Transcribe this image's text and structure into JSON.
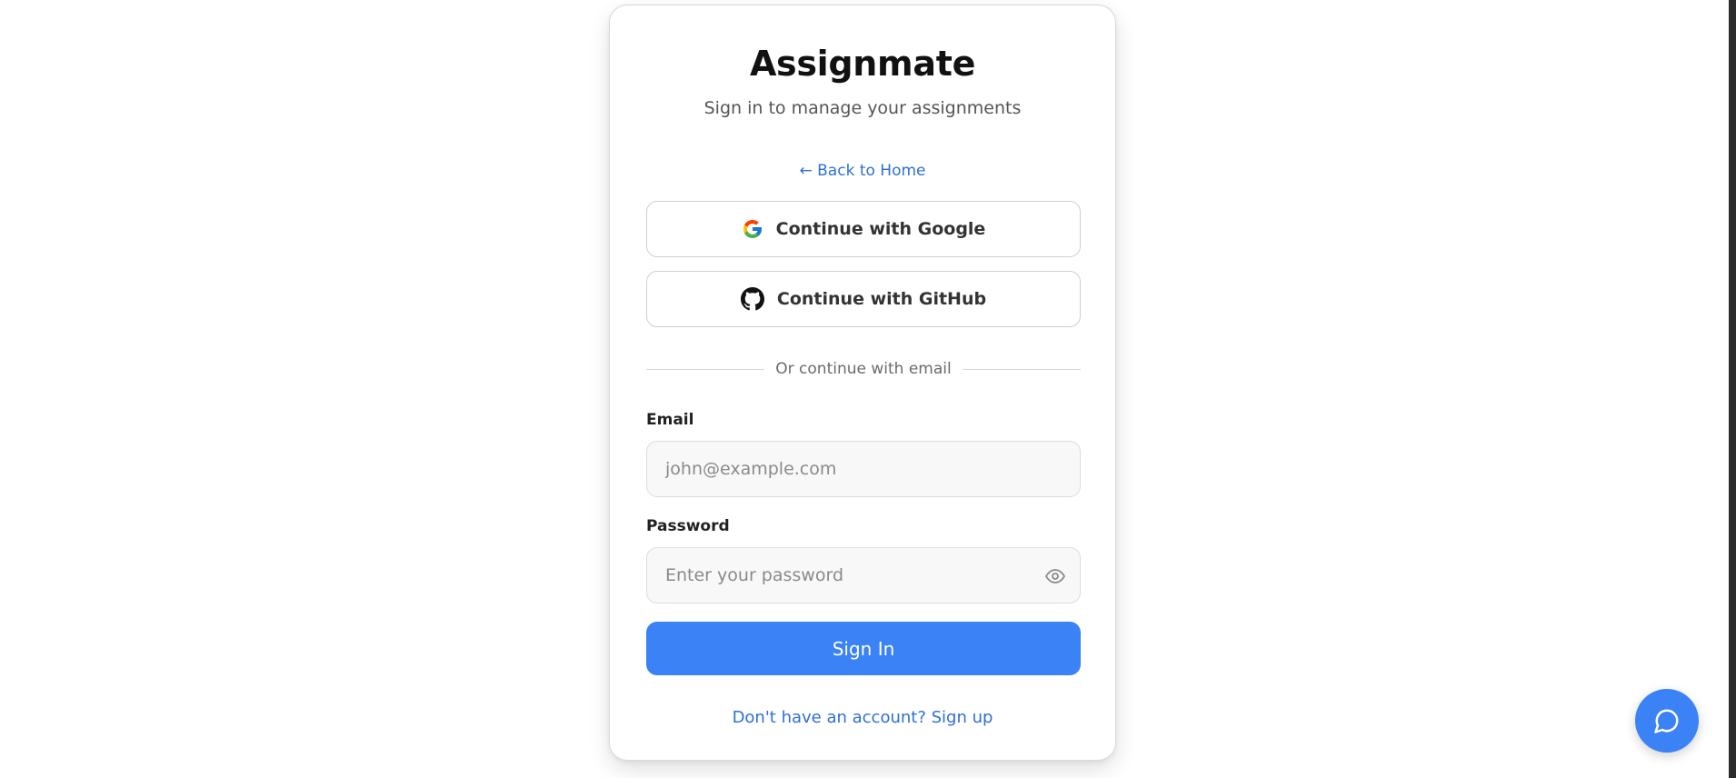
{
  "app": {
    "title": "Assignmate",
    "subtitle": "Sign in to manage your assignments"
  },
  "nav": {
    "back_link": "← Back to Home"
  },
  "oauth": {
    "google_label": "Continue with Google",
    "github_label": "Continue with GitHub",
    "google_icon": "google-icon",
    "github_icon": "github-icon"
  },
  "divider": {
    "text": "Or continue with email"
  },
  "form": {
    "email_label": "Email",
    "email_placeholder": "john@example.com",
    "email_value": "",
    "password_label": "Password",
    "password_placeholder": "Enter your password",
    "password_value": "",
    "password_toggle_icon": "eye-icon",
    "submit_label": "Sign In"
  },
  "footer": {
    "signup_link": "Don't have an account? Sign up"
  },
  "chat": {
    "icon": "chat-bubble-icon"
  },
  "colors": {
    "accent": "#3b82f6",
    "link": "#2f6fd6",
    "title": "#111111",
    "muted": "#555555"
  }
}
